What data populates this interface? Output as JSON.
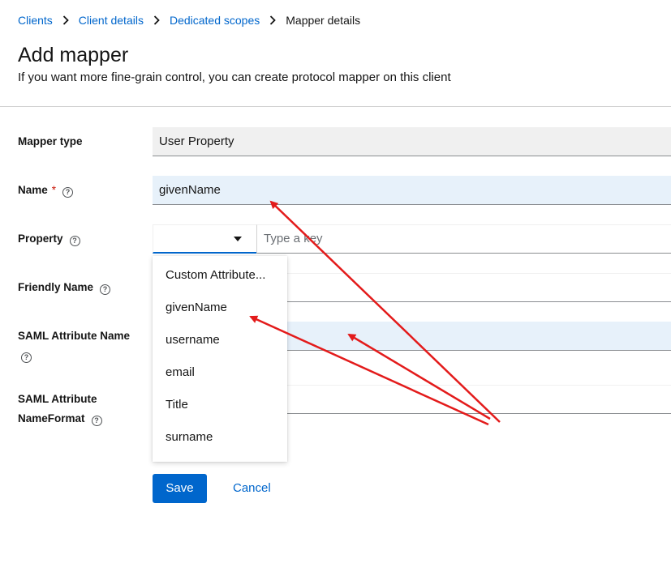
{
  "breadcrumb": {
    "items": [
      "Clients",
      "Client details",
      "Dedicated scopes"
    ],
    "current": "Mapper details"
  },
  "header": {
    "title": "Add mapper",
    "description": "If you want more fine-grain control, you can create protocol mapper on this client"
  },
  "form": {
    "mapper_type": {
      "label": "Mapper type",
      "value": "User Property"
    },
    "name": {
      "label": "Name",
      "required_mark": "*",
      "value": "givenName"
    },
    "property": {
      "label": "Property",
      "selected": "",
      "key_placeholder": "Type a key"
    },
    "friendly_name": {
      "label": "Friendly Name",
      "value": ""
    },
    "saml_attribute_name": {
      "label": "SAML Attribute Name",
      "value": ""
    },
    "saml_attribute_nameformat": {
      "label_line1": "SAML Attribute",
      "label_line2": "NameFormat",
      "value": ""
    },
    "help_glyph": "?"
  },
  "dropdown": {
    "options": [
      "Custom Attribute...",
      "givenName",
      "username",
      "email",
      "Title",
      "surname"
    ]
  },
  "actions": {
    "save_label": "Save",
    "cancel_label": "Cancel"
  },
  "annotation": {
    "arrow_color": "#e31b1b"
  }
}
